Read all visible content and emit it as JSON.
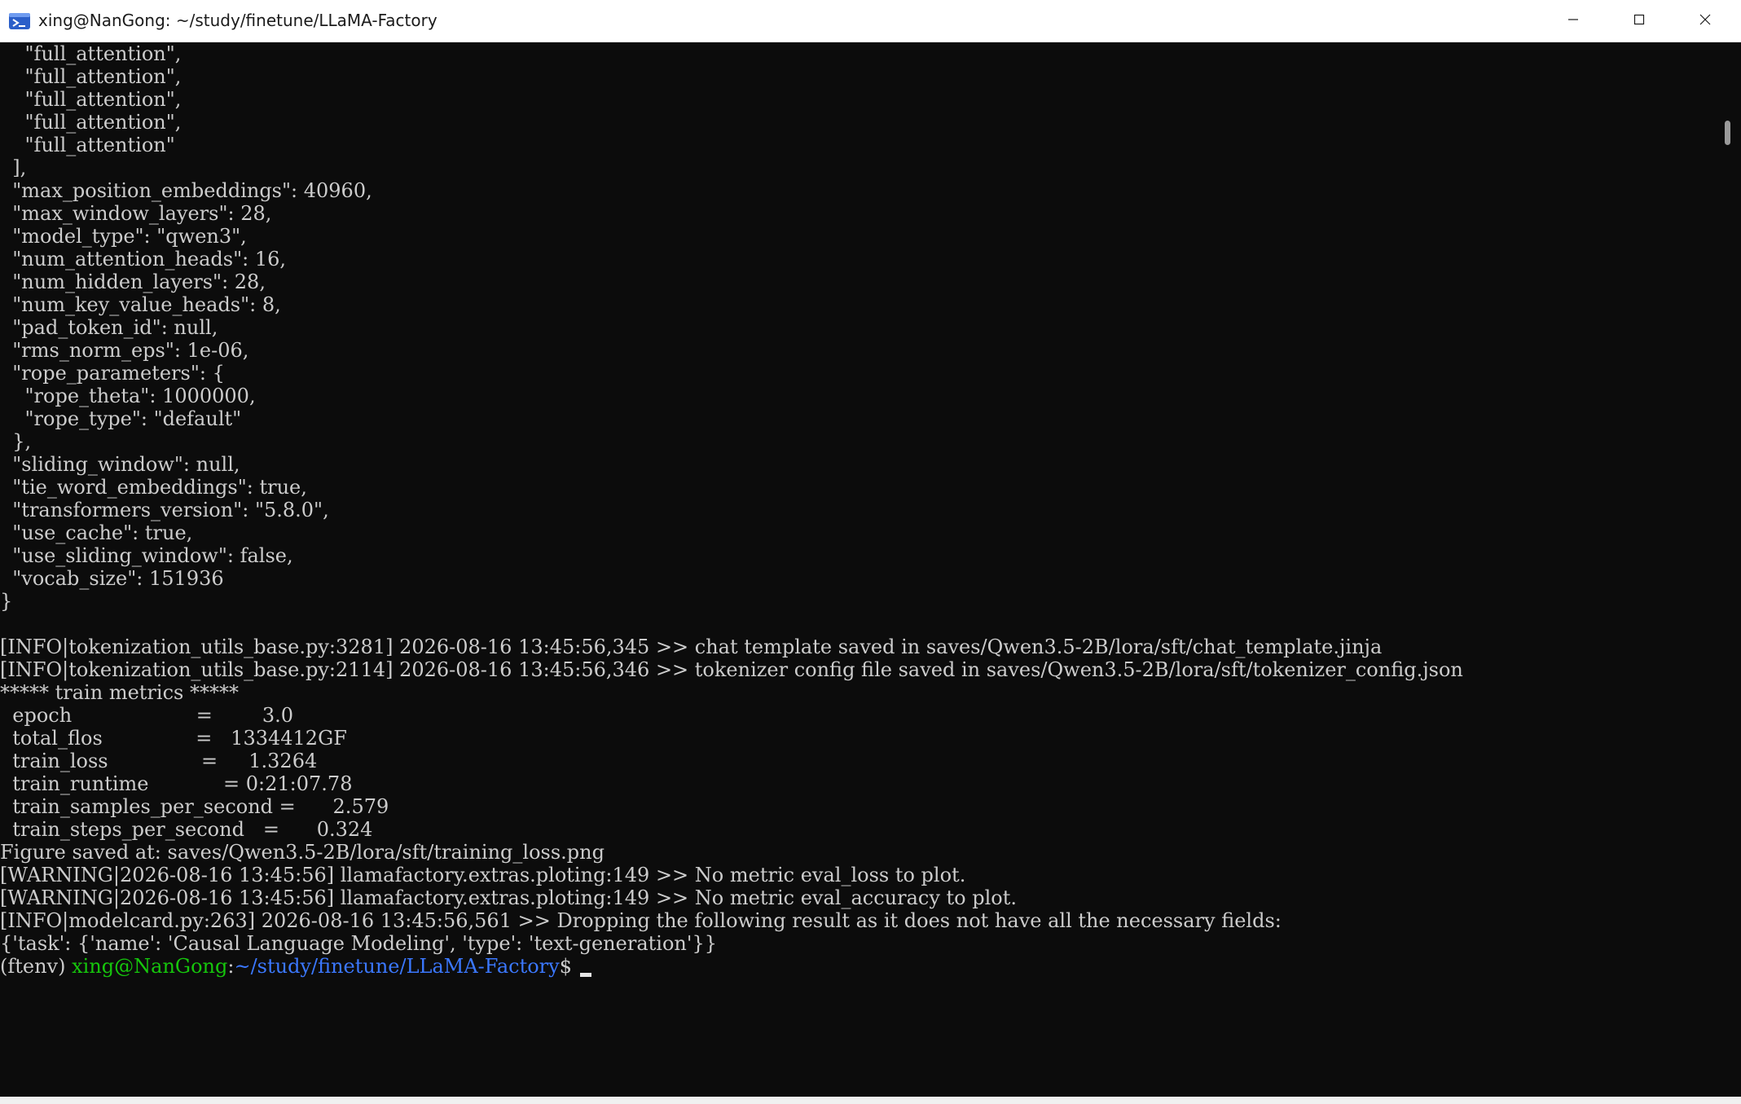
{
  "window": {
    "title": "xing@NanGong: ~/study/finetune/LLaMA-Factory",
    "icon": "terminal-icon",
    "controls": {
      "minimize_icon": "minimize-icon",
      "maximize_icon": "maximize-icon",
      "close_icon": "close-icon"
    }
  },
  "terminal": {
    "background": "#0c0c0c",
    "foreground": "#cccccc",
    "lines": [
      "    \"full_attention\",",
      "    \"full_attention\",",
      "    \"full_attention\",",
      "    \"full_attention\",",
      "    \"full_attention\"",
      "  ],",
      "  \"max_position_embeddings\": 40960,",
      "  \"max_window_layers\": 28,",
      "  \"model_type\": \"qwen3\",",
      "  \"num_attention_heads\": 16,",
      "  \"num_hidden_layers\": 28,",
      "  \"num_key_value_heads\": 8,",
      "  \"pad_token_id\": null,",
      "  \"rms_norm_eps\": 1e-06,",
      "  \"rope_parameters\": {",
      "    \"rope_theta\": 1000000,",
      "    \"rope_type\": \"default\"",
      "  },",
      "  \"sliding_window\": null,",
      "  \"tie_word_embeddings\": true,",
      "  \"transformers_version\": \"5.8.0\",",
      "  \"use_cache\": true,",
      "  \"use_sliding_window\": false,",
      "  \"vocab_size\": 151936",
      "}",
      "",
      "[INFO|tokenization_utils_base.py:3281] 2026-08-16 13:45:56,345 >> chat template saved in saves/Qwen3.5-2B/lora/sft/chat_template.jinja",
      "[INFO|tokenization_utils_base.py:2114] 2026-08-16 13:45:56,346 >> tokenizer config file saved in saves/Qwen3.5-2B/lora/sft/tokenizer_config.json",
      "***** train metrics *****",
      "  epoch                    =        3.0",
      "  total_flos               =   1334412GF",
      "  train_loss               =     1.3264",
      "  train_runtime            = 0:21:07.78",
      "  train_samples_per_second =      2.579",
      "  train_steps_per_second   =      0.324",
      "Figure saved at: saves/Qwen3.5-2B/lora/sft/training_loss.png",
      "[WARNING|2026-08-16 13:45:56] llamafactory.extras.ploting:149 >> No metric eval_loss to plot.",
      "[WARNING|2026-08-16 13:45:56] llamafactory.extras.ploting:149 >> No metric eval_accuracy to plot.",
      "[INFO|modelcard.py:263] 2026-08-16 13:45:56,561 >> Dropping the following result as it does not have all the necessary fields:",
      "{'task': {'name': 'Causal Language Modeling', 'type': 'text-generation'}}"
    ],
    "prompt": {
      "env": "(ftenv) ",
      "user_host": "xing@NanGong",
      "colon": ":",
      "path": "~/study/finetune/LLaMA-Factory",
      "symbol": "$ ",
      "user_color": "#16c60c",
      "path_color": "#3b78ff"
    }
  }
}
